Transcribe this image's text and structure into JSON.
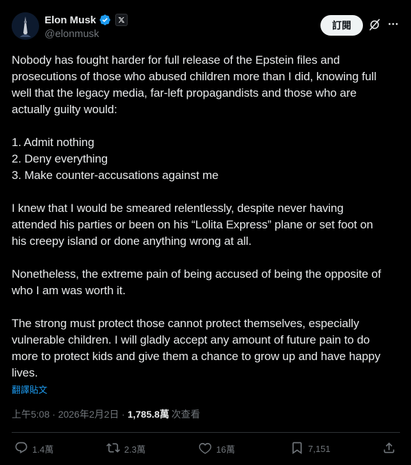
{
  "author": {
    "display_name": "Elon Musk",
    "handle": "@elonmusk",
    "verified_icon": "verified-badge-icon",
    "affiliation_icon": "x-logo-icon"
  },
  "header": {
    "subscribe_label": "訂閱",
    "grok_icon": "grok-icon",
    "more_icon": "more-horizontal-icon"
  },
  "tweet": {
    "text": "Nobody has fought harder for full release of the Epstein files and\nprosecutions of those who abused children more than I did, knowing full\nwell that the legacy media, far-left propagandists and those who are\nactually guilty would:\n\n1. Admit nothing\n2. Deny everything\n3. Make counter-accusations against me\n\nI knew that I would be smeared relentlessly, despite never having\nattended his parties or been on his “Lolita Express” plane or set foot on\nhis creepy island or done anything wrong at all.\n\nNonetheless, the extreme pain of being accused of being the opposite of\nwho I am was worth it.\n\nThe strong must protect those cannot protect themselves, especially\nvulnerable children. I will gladly accept any amount of future pain to do\nmore to protect kids and give them a chance to grow up and have happy\nlives.",
    "translate_label": "翻譯貼文",
    "time": "上午5:08 · 2026年2月2日 · ",
    "views_count": "1,785.8萬",
    "views_label": "次查看"
  },
  "actions": {
    "replies": "1.4萬",
    "reposts": "2.3萬",
    "likes": "16萬",
    "bookmarks": "7,151"
  },
  "colors": {
    "background": "#000000",
    "text": "#e7e9ea",
    "secondary": "#71767b",
    "link": "#1d9bf0",
    "verified": "#1d9bf0"
  }
}
